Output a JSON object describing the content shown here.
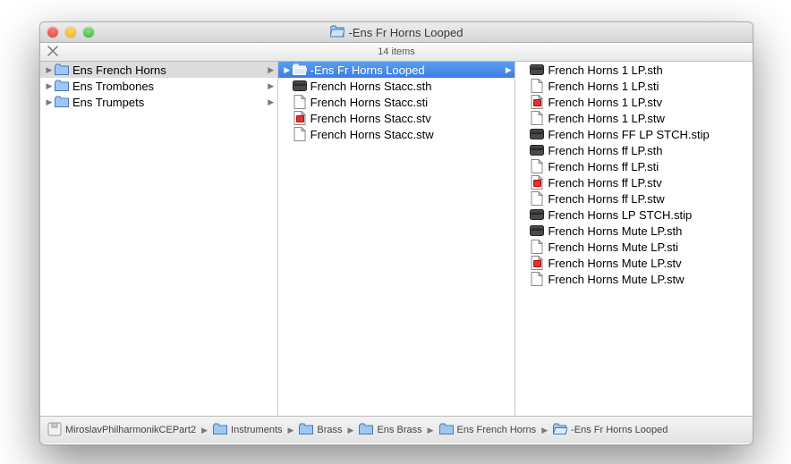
{
  "title": "-Ens Fr Horns Looped",
  "item_count_label": "14 items",
  "columns": [
    {
      "items": [
        {
          "label": "Ens French Horns",
          "icon": "folder",
          "has_children": true,
          "selected": "grey"
        },
        {
          "label": "Ens Trombones",
          "icon": "folder",
          "has_children": true
        },
        {
          "label": "Ens Trumpets",
          "icon": "folder",
          "has_children": true
        }
      ]
    },
    {
      "items": [
        {
          "label": "-Ens Fr Horns Looped",
          "icon": "folder-open",
          "has_children": true,
          "selected": "blue"
        },
        {
          "label": "French Horns Stacc.sth",
          "icon": "dark"
        },
        {
          "label": "French Horns Stacc.sti",
          "icon": "file"
        },
        {
          "label": "French Horns Stacc.stv",
          "icon": "file-red"
        },
        {
          "label": "French Horns Stacc.stw",
          "icon": "file"
        }
      ]
    },
    {
      "items": [
        {
          "label": "French Horns 1 LP.sth",
          "icon": "dark"
        },
        {
          "label": "French Horns 1 LP.sti",
          "icon": "file"
        },
        {
          "label": "French Horns 1 LP.stv",
          "icon": "file-red"
        },
        {
          "label": "French Horns 1 LP.stw",
          "icon": "file"
        },
        {
          "label": "French Horns FF LP STCH.stip",
          "icon": "dark"
        },
        {
          "label": "French Horns ff LP.sth",
          "icon": "dark"
        },
        {
          "label": "French Horns ff LP.sti",
          "icon": "file"
        },
        {
          "label": "French Horns ff LP.stv",
          "icon": "file-red"
        },
        {
          "label": "French Horns ff LP.stw",
          "icon": "file"
        },
        {
          "label": "French Horns LP STCH.stip",
          "icon": "dark"
        },
        {
          "label": "French Horns Mute LP.sth",
          "icon": "dark"
        },
        {
          "label": "French Horns Mute LP.sti",
          "icon": "file"
        },
        {
          "label": "French Horns Mute LP.stv",
          "icon": "file-red"
        },
        {
          "label": "French Horns Mute LP.stw",
          "icon": "file"
        }
      ]
    }
  ],
  "path": [
    {
      "label": "MiroslavPhilharmonikCEPart2",
      "icon": "disk"
    },
    {
      "label": "Instruments",
      "icon": "folder"
    },
    {
      "label": "Brass",
      "icon": "folder"
    },
    {
      "label": "Ens Brass",
      "icon": "folder"
    },
    {
      "label": "Ens French Horns",
      "icon": "folder"
    },
    {
      "label": "-Ens Fr Horns Looped",
      "icon": "folder-open"
    }
  ]
}
